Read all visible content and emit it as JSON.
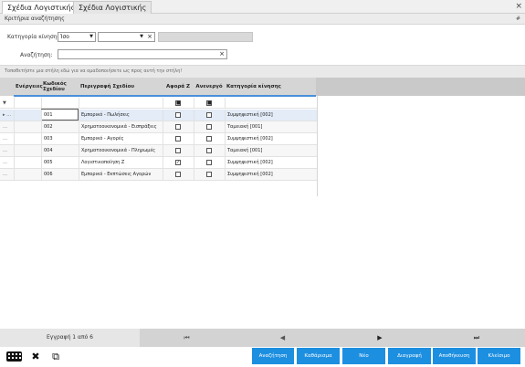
{
  "tabs": [
    "Σχέδια Λογιστικής",
    "Σχέδια Λογιστικής"
  ],
  "close_glyph": "×",
  "criteria": {
    "title": "Κριτήρια αναζήτησης",
    "pin": "#",
    "category_label": "Κατηγορία κίνησης:",
    "operator_value": "Ίσο",
    "category_value": "",
    "search_label": "Αναζήτηση:",
    "search_value": ""
  },
  "group_hint": "Τοποθετήστε μια στήλη εδώ για να ομαδοποιήσετε ως προς αυτή την στήλη!",
  "columns": {
    "actions": "Ενέργειες",
    "code": "Κωδικός Σχεδίου",
    "description": "Περιγραφή Σχεδίου",
    "affects_z": "Αφορά Ζ",
    "inactive": "Ανενεργό",
    "category": "Κατηγορία κίνησης"
  },
  "rows": [
    {
      "code": "001",
      "description": "Εμπορικό - Πωλήσεις",
      "affects_z": false,
      "inactive": false,
      "category": "Συμψηφιστική [002]"
    },
    {
      "code": "002",
      "description": "Χρηματοοικονομικά - Εισπράξεις",
      "affects_z": false,
      "inactive": false,
      "category": "Ταμειακή [001]"
    },
    {
      "code": "003",
      "description": "Εμπορικό - Αγορές",
      "affects_z": false,
      "inactive": false,
      "category": "Συμψηφιστική [002]"
    },
    {
      "code": "004",
      "description": "Χρηματοοικονομικά - Πληρωμές",
      "affects_z": false,
      "inactive": false,
      "category": "Ταμειακή [001]"
    },
    {
      "code": "005",
      "description": "Λογιστικοποίηση Ζ",
      "affects_z": true,
      "inactive": false,
      "category": "Συμψηφιστική [002]"
    },
    {
      "code": "006",
      "description": "Εμπορικό - Εκπτώσεις Αγορών",
      "affects_z": false,
      "inactive": false,
      "category": "Συμψηφιστική [002]"
    }
  ],
  "pager": {
    "record_text": "Εγγραφή 1 από 6",
    "first": "⏮",
    "prev": "◀",
    "next": "▶",
    "last": "⏭"
  },
  "buttons": {
    "search": "Αναζήτηση",
    "clear": "Καθάρισμα",
    "new": "Νέο",
    "delete": "Διαγραφή",
    "save": "Αποθήκευση",
    "close": "Κλείσιμο"
  },
  "colors": {
    "accent": "#1d8fe0",
    "header_line": "#4a90d9"
  }
}
